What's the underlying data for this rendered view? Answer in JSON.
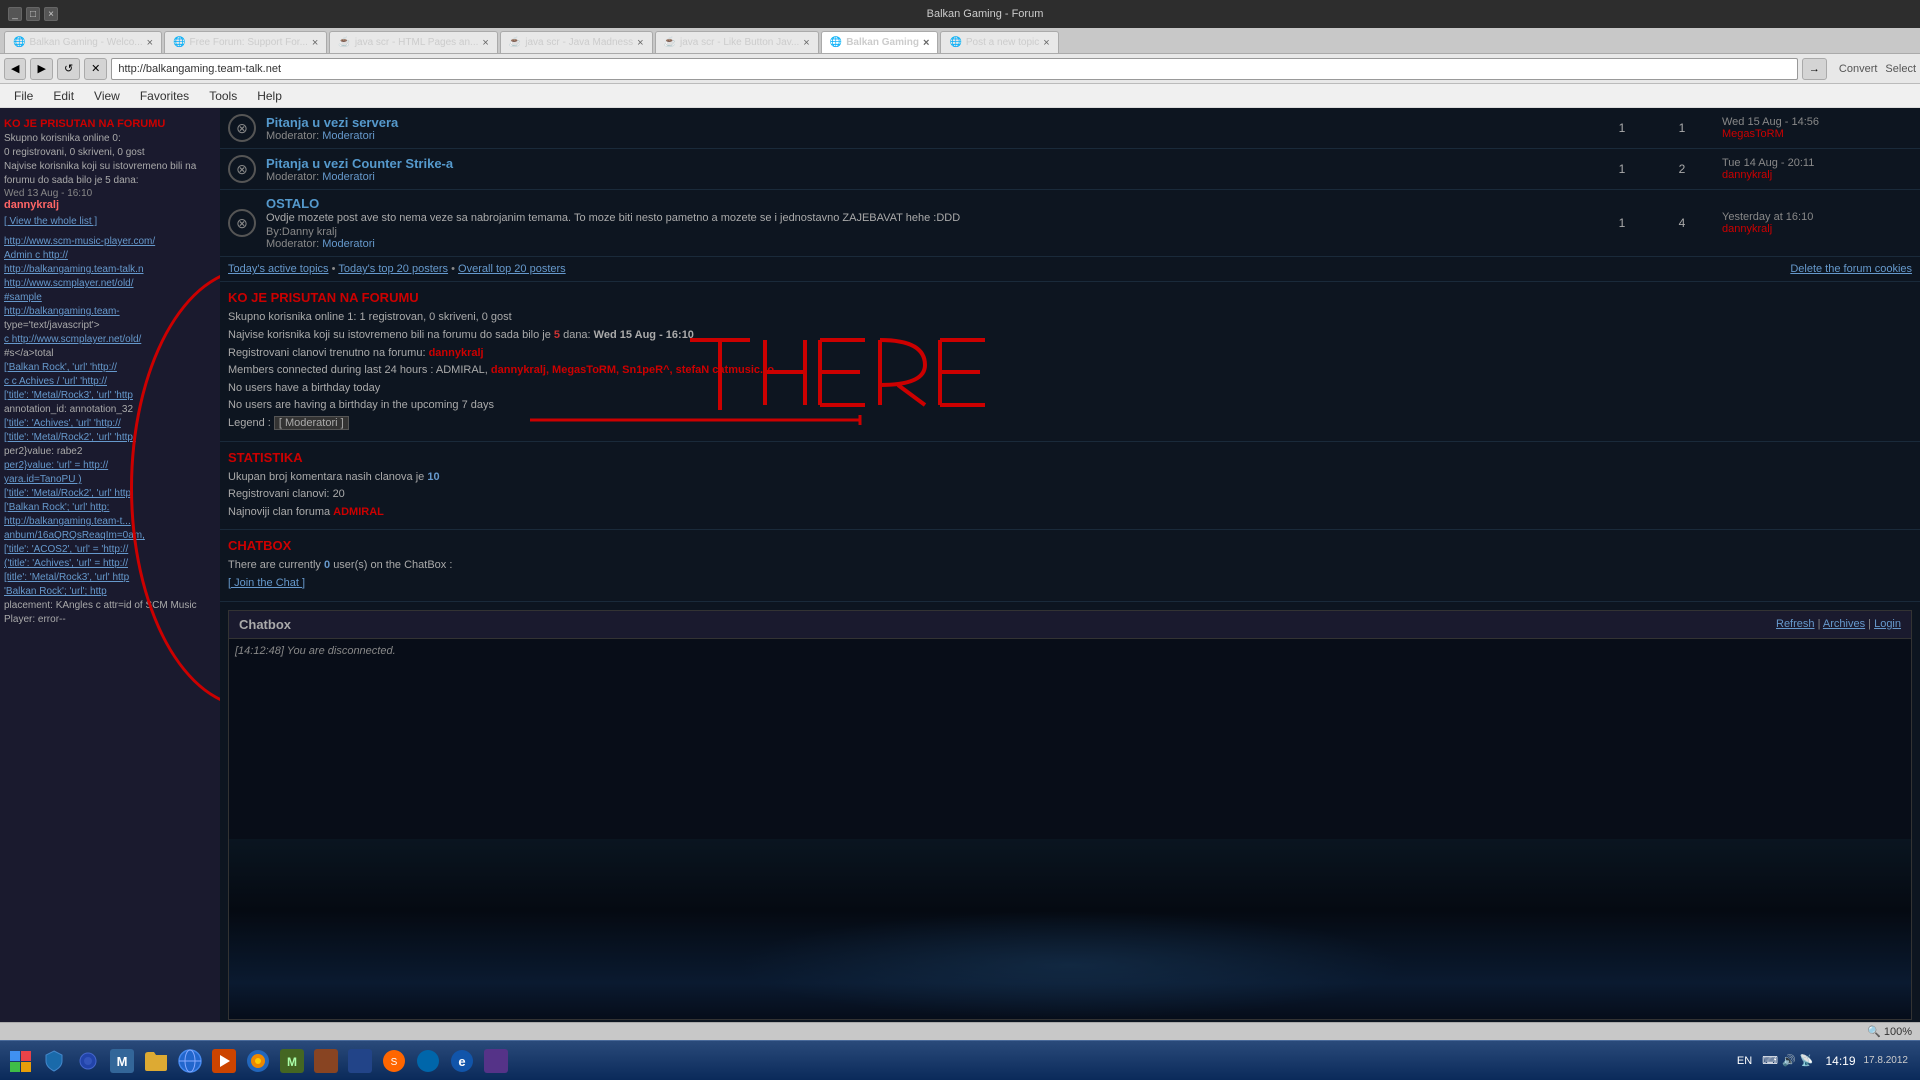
{
  "browser": {
    "title": "Balkan Gaming - Forum",
    "address": "http://balkangaming.team-talk.net",
    "tabs": [
      {
        "label": "Balkan Gaming - Welco...",
        "active": false,
        "favicon": "🌐"
      },
      {
        "label": "Free Forum: Support For...",
        "active": false,
        "favicon": "🌐"
      },
      {
        "label": "java scr - HTML Pages an...",
        "active": false,
        "favicon": "🌐"
      },
      {
        "label": "java scr - Java Madness",
        "active": false,
        "favicon": "🌐"
      },
      {
        "label": "java scr - Like Button Jav...",
        "active": false,
        "favicon": "🌐"
      },
      {
        "label": "Balkan Gaming",
        "active": true,
        "favicon": "🌐"
      },
      {
        "label": "Post a new topic",
        "active": false,
        "favicon": "🌐"
      }
    ],
    "menus": [
      "File",
      "Edit",
      "View",
      "Favorites",
      "Tools",
      "Help"
    ],
    "convert_label": "Convert",
    "select_label": "Select"
  },
  "sidebar": {
    "section_title": "KO JE PRISUTAN NA FORUMU",
    "users_online": "Skupno korisnika online 0:",
    "users_detail": "0 registrovani, 0 skriveni, 0 gost",
    "view_list": "[ View the whole list ]",
    "username": "dannykralj",
    "recent_text": "Najvise korisnika koji su istovremeno bili na forumu do sada bilo je 5 dana:",
    "recent_date": "Wed 13 Aug - 16:10",
    "links": [
      "http://www.scm-music-player.com/",
      "Admin c http://",
      "http://balkangaming.team-talk.n",
      "http://www.scmplayer.net/old/",
      "#sample",
      "http://balkangaming.team-",
      "type='text/javascript'>",
      "c http://www.scmplayer.net/old/",
      "#s</a>total",
      "['Balkan Rock', 'url' 'http://",
      "c c Achives / 'url' 'http://",
      "['title': 'Metal/Rock3', 'url' 'http",
      "annotation_id: annotation_32",
      "['title': 'Achives', 'url' 'http://",
      "['title': 'Metal/Rock2', 'url' 'http:",
      "per2}value: rabe2",
      "per2}value: 'url' = http://",
      "yara.id=TanoPU )",
      "['title': 'Metal/Rock2', 'url' http",
      "['Balkan Rock'; 'url' http:",
      "http://balkangaming.team-t...",
      "anbum/16aQRQsReaqIm=0am,",
      "['title': 'ACOS2', 'url' = 'http://",
      "('title': 'Achives', 'url' = http://",
      "[title': 'Metal/Rock3', 'url' http",
      "'Balkan Rock'; 'url'; http",
      "placement:",
      "KAngles",
      "c attr=id of SCM Music Player:",
      "error--"
    ]
  },
  "forum": {
    "rows": [
      {
        "title": "Pitanja u vezi servera",
        "moderator": "Moderatori",
        "topics": 1,
        "posts": 1,
        "last_date": "Wed 15 Aug - 14:56",
        "last_user": "MegasToRM"
      },
      {
        "title": "Pitanja u vezi Counter Strike-a",
        "moderator": "Moderatori",
        "topics": 1,
        "posts": 2,
        "last_date": "Tue 14 Aug - 20:11",
        "last_user": "dannykralj"
      },
      {
        "title": "OSTALO",
        "moderator": "Moderatori",
        "desc": "Ovdje mozete post ave sto nema veze sa nabrojanim temama. To moze biti nesto pametno a mozete se i jednostavno ZAJEBAVAT hehe :DDD",
        "by": "Danny kralj",
        "topics": 1,
        "posts": 4,
        "last_date": "Yesterday at 16:10",
        "last_user": "dannykralj"
      }
    ],
    "footer_links": {
      "left": [
        "Today's active topics",
        "Today's top 20 posters",
        "Overall top 20 posters"
      ],
      "right": "Delete the forum cookies"
    }
  },
  "who_online": {
    "title": "KO JE PRISUTAN NA FORUMU",
    "total": "Skupno korisnika online 1:",
    "detail": "1 registrovan, 0 skriveni, 0 gost",
    "peak_text": "Najvise korisnika koji su istovremeno bili na forumu do sada bilo je",
    "peak_num": "5",
    "peak_text2": "dana:",
    "peak_date": "Wed 15 Aug - 16:10",
    "registered_text": "Registrovani clanovi trenutno na forumu:",
    "registered_user": "dannykralj",
    "connected_24h": "Members connected during last 24 hours : ADMIRAL,",
    "connected_users": "dannykralj, MegasToRM, Sn1peR^, stefaN catmusic.ro",
    "birthday_today": "No users have a birthday today",
    "birthday_upcoming": "No users are having a birthday in the upcoming 7 days",
    "legend": "Legend : [ Moderatori ]"
  },
  "statistics": {
    "title": "STATISTIKA",
    "comments_text": "Ukupan broj komentara nasih clanova je",
    "comments_num": "10",
    "members_text": "Registrovani clanovi:",
    "members_num": "20",
    "newest_text": "Najnoviji clan foruma",
    "newest_user": "ADMIRAL"
  },
  "chatbox_section": {
    "title": "CHATBOX",
    "online_text": "There are currently",
    "online_num": "0",
    "online_text2": "user(s) on the ChatBox :",
    "join_link": "[ Join the Chat ]"
  },
  "chatbox": {
    "title": "Chatbox",
    "refresh": "Refresh",
    "archives": "Archives",
    "login": "Login",
    "message": "[14:12:48] You are disconnected."
  },
  "annotation": {
    "here_text": "HERE",
    "t_text": "T"
  },
  "taskbar": {
    "time": "14:19",
    "date": "17.8.2012",
    "language": "EN",
    "zoom": "100%"
  },
  "status_bar": {
    "zoom": "100%"
  }
}
